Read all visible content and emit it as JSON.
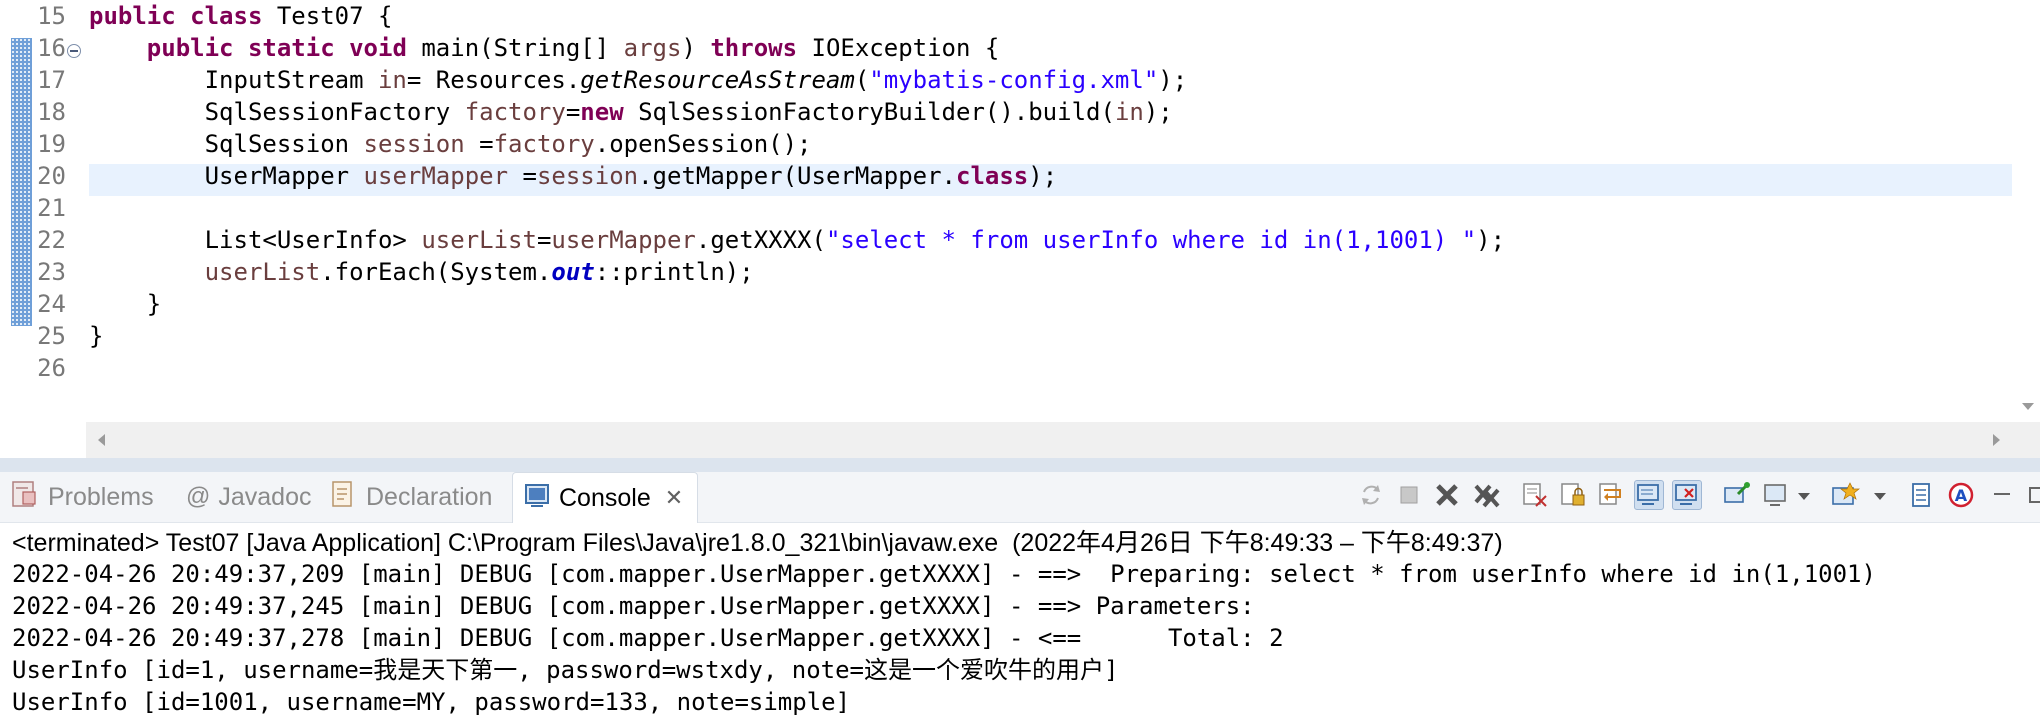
{
  "editor": {
    "lines": [
      {
        "num": "15",
        "tokens": [
          {
            "t": "public",
            "c": "kw"
          },
          {
            "t": " "
          },
          {
            "t": "class",
            "c": "kw"
          },
          {
            "t": " Test07 {"
          }
        ]
      },
      {
        "num": "16",
        "tokens": [
          {
            "t": "    "
          },
          {
            "t": "public",
            "c": "kw"
          },
          {
            "t": " "
          },
          {
            "t": "static",
            "c": "kw"
          },
          {
            "t": " "
          },
          {
            "t": "void",
            "c": "kw"
          },
          {
            "t": " main(String[] "
          },
          {
            "t": "args",
            "c": "fld"
          },
          {
            "t": ") "
          },
          {
            "t": "throws",
            "c": "kw"
          },
          {
            "t": " IOException {"
          }
        ]
      },
      {
        "num": "17",
        "tokens": [
          {
            "t": "        InputStream "
          },
          {
            "t": "in",
            "c": "fld"
          },
          {
            "t": "= Resources."
          },
          {
            "t": "getResourceAsStream",
            "c": "it"
          },
          {
            "t": "("
          },
          {
            "t": "\"mybatis-config.xml\"",
            "c": "str"
          },
          {
            "t": ");"
          }
        ]
      },
      {
        "num": "18",
        "tokens": [
          {
            "t": "        SqlSessionFactory "
          },
          {
            "t": "factory",
            "c": "fld"
          },
          {
            "t": "="
          },
          {
            "t": "new",
            "c": "kw"
          },
          {
            "t": " SqlSessionFactoryBuilder().build("
          },
          {
            "t": "in",
            "c": "fld"
          },
          {
            "t": ");"
          }
        ]
      },
      {
        "num": "19",
        "tokens": [
          {
            "t": "        SqlSession "
          },
          {
            "t": "session",
            "c": "fld"
          },
          {
            "t": " ="
          },
          {
            "t": "factory",
            "c": "fld"
          },
          {
            "t": ".openSession();"
          }
        ]
      },
      {
        "num": "20",
        "tokens": [
          {
            "t": "        UserMapper "
          },
          {
            "t": "userMapper",
            "c": "fld"
          },
          {
            "t": " ="
          },
          {
            "t": "session",
            "c": "fld"
          },
          {
            "t": ".getMapper(UserMapper."
          },
          {
            "t": "class",
            "c": "kw"
          },
          {
            "t": ");"
          }
        ]
      },
      {
        "num": "21",
        "tokens": []
      },
      {
        "num": "22",
        "tokens": [
          {
            "t": "        List<UserInfo> "
          },
          {
            "t": "userList",
            "c": "fld"
          },
          {
            "t": "="
          },
          {
            "t": "userMapper",
            "c": "fld"
          },
          {
            "t": ".getXXXX("
          },
          {
            "t": "\"select * from userInfo where id in(1,1001) \"",
            "c": "str"
          },
          {
            "t": ");"
          }
        ]
      },
      {
        "num": "23",
        "tokens": [
          {
            "t": "        "
          },
          {
            "t": "userList",
            "c": "fld"
          },
          {
            "t": ".forEach(System."
          },
          {
            "t": "out",
            "c": "sfld"
          },
          {
            "t": "::println);"
          }
        ]
      },
      {
        "num": "24",
        "tokens": [
          {
            "t": "    }"
          }
        ]
      },
      {
        "num": "25",
        "tokens": [
          {
            "t": "}"
          }
        ]
      },
      {
        "num": "26",
        "tokens": []
      }
    ]
  },
  "panel": {
    "tabs": [
      {
        "label": "Problems",
        "icon": "problems-icon"
      },
      {
        "label": "Javadoc",
        "icon": "javadoc-icon"
      },
      {
        "label": "Declaration",
        "icon": "declaration-icon"
      },
      {
        "label": "Console",
        "icon": "console-icon",
        "active": true
      }
    ],
    "toolbar_icons": [
      "sync-icon",
      "terminate-icon",
      "remove-launch-icon",
      "remove-all-terminated-icon",
      "clear-console-icon",
      "scroll-lock-icon",
      "word-wrap-icon",
      "show-on-stdout-icon",
      "show-on-stderr-icon",
      "pin-console-icon",
      "display-console-icon",
      "open-console-icon",
      "copy-icon",
      "settings-icon",
      "minimize-icon",
      "maximize-icon"
    ],
    "console": {
      "header": "<terminated> Test07 [Java Application] C:\\Program Files\\Java\\jre1.8.0_321\\bin\\javaw.exe  (2022年4月26日 下午8:49:33 – 下午8:49:37)",
      "lines": [
        "2022-04-26 20:49:37,209 [main] DEBUG [com.mapper.UserMapper.getXXXX] - ==>  Preparing: select * from userInfo where id in(1,1001)",
        "2022-04-26 20:49:37,245 [main] DEBUG [com.mapper.UserMapper.getXXXX] - ==> Parameters: ",
        "2022-04-26 20:49:37,278 [main] DEBUG [com.mapper.UserMapper.getXXXX] - <==      Total: 2",
        "UserInfo [id=1, username=我是天下第一, password=wstxdy, note=这是一个爱吹牛的用户]",
        "UserInfo [id=1001, username=MY, password=133, note=simple]"
      ]
    }
  }
}
